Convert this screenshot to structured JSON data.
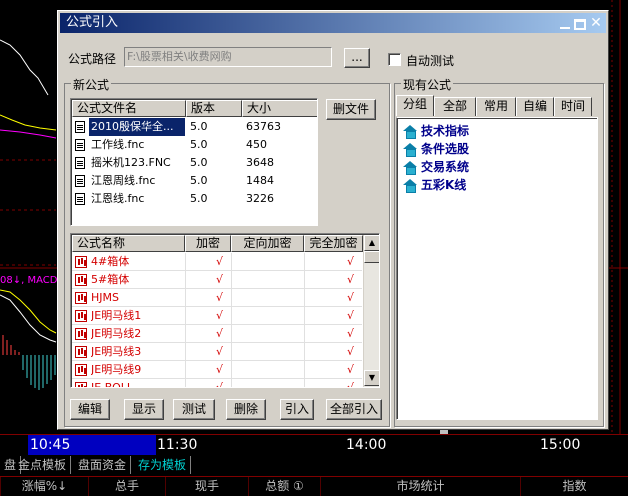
{
  "dialog": {
    "title": "公式引入",
    "path_label": "公式路径",
    "path_value": "F:\\股票相关\\收费网购",
    "browse_label": "...",
    "auto_test_label": "自动测试",
    "new_formula_group": "新公式",
    "existing_formula_group": "现有公式",
    "delete_file_label": "删文件"
  },
  "file_table": {
    "headers": [
      "公式文件名",
      "版本",
      "大小"
    ],
    "rows": [
      {
        "name": "2010殷保华全...",
        "version": "5.0",
        "size": "63763",
        "selected": true
      },
      {
        "name": "工作线.fnc",
        "version": "5.0",
        "size": "450"
      },
      {
        "name": "摇米机123.FNC",
        "version": "5.0",
        "size": "3648"
      },
      {
        "name": "江恩周线.fnc",
        "version": "5.0",
        "size": "1484"
      },
      {
        "name": "江恩线.fnc",
        "version": "5.0",
        "size": "3226"
      }
    ]
  },
  "formula_table": {
    "headers": [
      "公式名称",
      "加密",
      "定向加密",
      "完全加密"
    ],
    "rows": [
      {
        "name": "4#箱体",
        "enc": "√",
        "dir": "",
        "full": "√"
      },
      {
        "name": "5#箱体",
        "enc": "√",
        "dir": "",
        "full": "√"
      },
      {
        "name": "HJMS",
        "enc": "√",
        "dir": "",
        "full": "√"
      },
      {
        "name": "JE明马线1",
        "enc": "√",
        "dir": "",
        "full": "√"
      },
      {
        "name": "JE明马线2",
        "enc": "√",
        "dir": "",
        "full": "√"
      },
      {
        "name": "JE明马线3",
        "enc": "√",
        "dir": "",
        "full": "√"
      },
      {
        "name": "JE明马线9",
        "enc": "√",
        "dir": "",
        "full": "√"
      },
      {
        "name": "JE-BOLL",
        "enc": "√",
        "dir": "",
        "full": "√"
      }
    ]
  },
  "tabs": [
    "分组",
    "全部",
    "常用",
    "自编",
    "时间"
  ],
  "tree": [
    "技术指标",
    "条件选股",
    "交易系统",
    "五彩K线"
  ],
  "actions": [
    "编辑",
    "显示",
    "测试",
    "删除",
    "引入",
    "全部引入"
  ],
  "background": {
    "macd_label": "08↓, MACD:",
    "times": [
      "10:45",
      "11:30",
      "14:00",
      "15:00"
    ],
    "bottom_tabs": [
      "盘",
      "金点模板",
      "盘面资金",
      "存为模板"
    ],
    "columns": [
      "涨幅%↓",
      "总手",
      "现手",
      "总额 ①",
      "市场统计",
      "指数"
    ]
  }
}
